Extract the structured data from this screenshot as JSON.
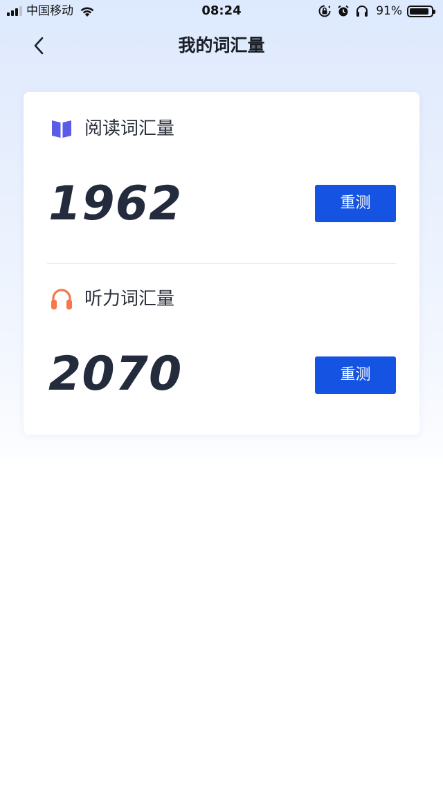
{
  "status_bar": {
    "carrier": "中国移动",
    "time": "08:24",
    "battery_percent": "91%",
    "battery_level": 0.91,
    "icons": [
      "signal-icon",
      "wifi-icon",
      "orientation-lock-icon",
      "alarm-icon",
      "headphones-icon",
      "battery-icon"
    ]
  },
  "header": {
    "title": "我的词汇量",
    "back_icon": "chevron-left-icon"
  },
  "sections": [
    {
      "title": "阅读词汇量",
      "icon": "book-icon",
      "icon_color": "#5b5ce6",
      "value": "1962",
      "button_label": "重测"
    },
    {
      "title": "听力词汇量",
      "icon": "headphones-icon",
      "icon_color": "#f7774a",
      "value": "2070",
      "button_label": "重测"
    }
  ],
  "colors": {
    "accent": "#1553e2",
    "value_text": "#232b3d"
  }
}
